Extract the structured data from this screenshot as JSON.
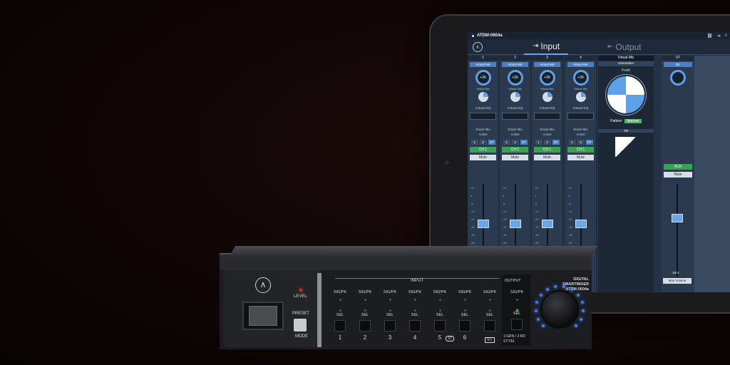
{
  "app": {
    "title": "ATDM-0604a",
    "tabs": [
      {
        "label": "Input",
        "icon": "input-arrow-icon",
        "active": true
      },
      {
        "label": "Output",
        "icon": "output-arrow-icon",
        "active": false
      }
    ]
  },
  "channels": [
    {
      "number": "1",
      "source": "Virtual Mic",
      "gain": "+36",
      "mode_label": "Virtual Mic",
      "eq_label": "4 Band EQ",
      "smart_mix_label": "Smart Mix",
      "smart_mix_state": "Active",
      "route": "CH 1",
      "mute": "Mute"
    },
    {
      "number": "2",
      "source": "Virtual Mic",
      "gain": "+36",
      "mode_label": "Virtual Mic",
      "eq_label": "4 Band EQ",
      "smart_mix_label": "Smart Mix",
      "smart_mix_state": "Active",
      "route": "CH 1",
      "mute": "Mute"
    },
    {
      "number": "3",
      "source": "Virtual Mic",
      "gain": "+36",
      "mode_label": "Virtual Mic",
      "eq_label": "4 Band EQ",
      "smart_mix_label": "Smart Mix",
      "smart_mix_state": "Active",
      "route": "CH 1",
      "mute": "Mute"
    },
    {
      "number": "4",
      "source": "Virtual Mic",
      "gain": "+36",
      "mode_label": "Virtual Mic",
      "eq_label": "4 Band EQ",
      "smart_mix_label": "Smart Mix",
      "smart_mix_state": "Active",
      "route": "CH 1",
      "mute": "Mute"
    }
  ],
  "routing_buttons": [
    "1",
    "2",
    "ST"
  ],
  "fader_scale": [
    "+6",
    "0",
    "-6",
    "-12",
    "-20",
    "-30",
    "-40",
    "-60",
    "-∞"
  ],
  "virtual_mic": {
    "header": "Virtual Mic",
    "section": "Orientation",
    "front_label": "Front",
    "pattern_label": "Pattern",
    "pattern_value": "Normal",
    "tilt_label": "Tilt"
  },
  "st_strip": {
    "header": "ST",
    "source": "Dir",
    "route": "AUX",
    "mute": "Mute",
    "readout": "-18.4",
    "max_volume": "Max Volume"
  },
  "hardware": {
    "level_label": "LEVEL",
    "preset_label": "PRESET",
    "mode_label": "MODE",
    "input_label": "INPUT",
    "output_label": "OUTPUT",
    "sig_label": "SIG/PK",
    "sel_label": "SEL",
    "channel_numbers": [
      "1",
      "2",
      "3",
      "4",
      "5",
      "6",
      "ST"
    ],
    "st_link_label": "ST",
    "output_legend_1": "1:GRN / 2:RD",
    "output_legend_2": "ST:YEL",
    "brand_line_1": "DIGITAL SMARTMIXER",
    "brand_line_2": "ATDM-0604a",
    "level_led_color": "#ee2222",
    "output_led_color": "#2ecc55",
    "knob_ring_color": "#3c7bff"
  }
}
